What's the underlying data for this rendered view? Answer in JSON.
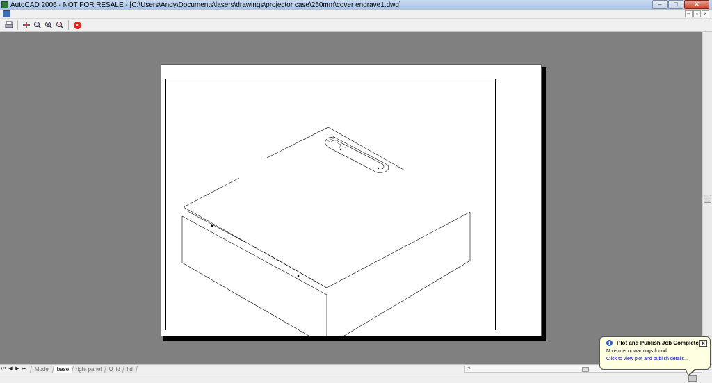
{
  "window": {
    "title": "AutoCAD 2006 - NOT FOR RESALE - [C:\\Users\\Andy\\Documents\\lasers\\drawings\\projector case\\250mm\\cover engrave1.dwg]",
    "minimize": "–",
    "maximize": "□",
    "close": "✕"
  },
  "mdi": {
    "minimize": "–",
    "restore": "▫",
    "close": "×"
  },
  "toolbar": {
    "icons": [
      "plot-icon",
      "pan-icon",
      "zoom-realtime-icon",
      "zoom-window-icon",
      "zoom-previous-icon",
      "close-preview-icon"
    ]
  },
  "layout_tabs": {
    "tabs": [
      "Model",
      "base",
      "right panel",
      "U lid",
      "lid"
    ],
    "active": "base"
  },
  "notification": {
    "title": "Plot and Publish Job Complete",
    "message": "No errors or warnings found",
    "link": "Click to view plot and publish details...",
    "close": "x",
    "info_glyph": "i"
  },
  "colors": {
    "canvas": "#808080",
    "balloon": "#ffffe1",
    "link": "#0000cc"
  }
}
